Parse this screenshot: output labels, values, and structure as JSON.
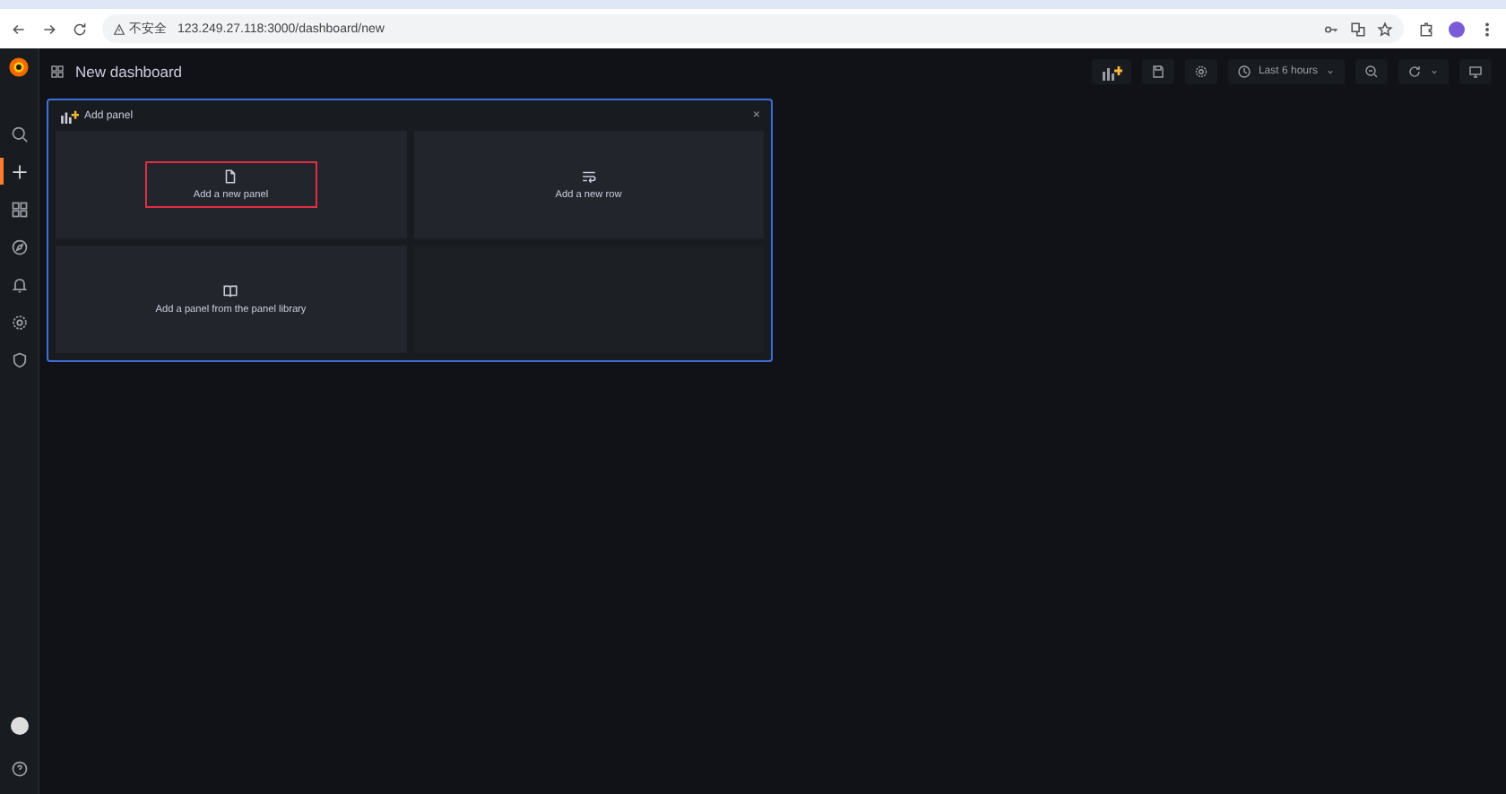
{
  "browser": {
    "security_label": "不安全",
    "url": "123.249.27.118:3000/dashboard/new"
  },
  "sidebar": {
    "items": [
      {
        "kind": "search",
        "selected": false
      },
      {
        "kind": "plus",
        "selected": true
      },
      {
        "kind": "dashboards",
        "selected": false
      },
      {
        "kind": "explore",
        "selected": false
      },
      {
        "kind": "alerting",
        "selected": false
      },
      {
        "kind": "settings",
        "selected": false
      },
      {
        "kind": "shield",
        "selected": false
      }
    ]
  },
  "dashboard": {
    "title": "New dashboard",
    "time_range": "Last 6 hours"
  },
  "add_panel": {
    "title": "Add panel",
    "close": "×",
    "options": [
      {
        "kind": "new-panel",
        "label": "Add a new panel",
        "highlighted": true
      },
      {
        "kind": "new-row",
        "label": "Add a new row",
        "highlighted": false
      },
      {
        "kind": "library",
        "label": "Add a panel from the panel library",
        "highlighted": false
      }
    ]
  }
}
